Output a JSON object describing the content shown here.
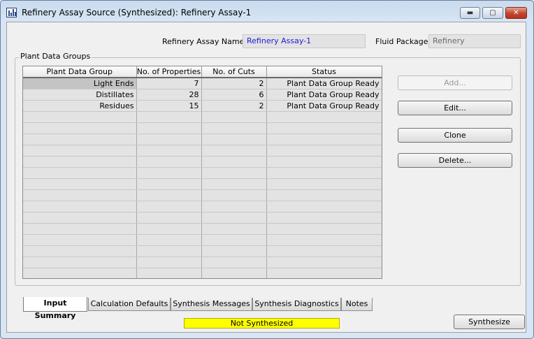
{
  "window": {
    "title": "Refinery Assay Source (Synthesized): Refinery Assay-1",
    "icon": "chart-app-icon",
    "controls": {
      "minimize": "▬",
      "maximize": "▢",
      "close": "✕"
    }
  },
  "header": {
    "assay_name_label": "Refinery Assay Name:",
    "assay_name_value": "Refinery Assay-1",
    "fluid_package_label": "Fluid Package:",
    "fluid_package_value": "Refinery"
  },
  "plant_data_groups": {
    "label": "Plant Data Groups",
    "columns": [
      "Plant Data Group",
      "No. of Properties",
      "No. of Cuts",
      "Status"
    ],
    "rows": [
      [
        "Light Ends",
        "7",
        "2",
        "Plant Data Group Ready"
      ],
      [
        "Distillates",
        "28",
        "6",
        "Plant Data Group Ready"
      ],
      [
        "Residues",
        "15",
        "2",
        "Plant Data Group Ready"
      ]
    ]
  },
  "buttons": {
    "add": "Add...",
    "edit": "Edit...",
    "clone": "Clone",
    "delete": "Delete..."
  },
  "tabs": [
    {
      "label": "Input Summary",
      "active": true
    },
    {
      "label": "Calculation Defaults"
    },
    {
      "label": "Synthesis Messages"
    },
    {
      "label": "Synthesis Diagnostics"
    },
    {
      "label": "Notes"
    }
  ],
  "status": {
    "text": "Not Synthesized",
    "color": "#ffff00"
  },
  "synthesize_button": "Synthesize",
  "colors": {
    "link_text": "#1a1ad6",
    "status_bg": "#ffff00"
  }
}
